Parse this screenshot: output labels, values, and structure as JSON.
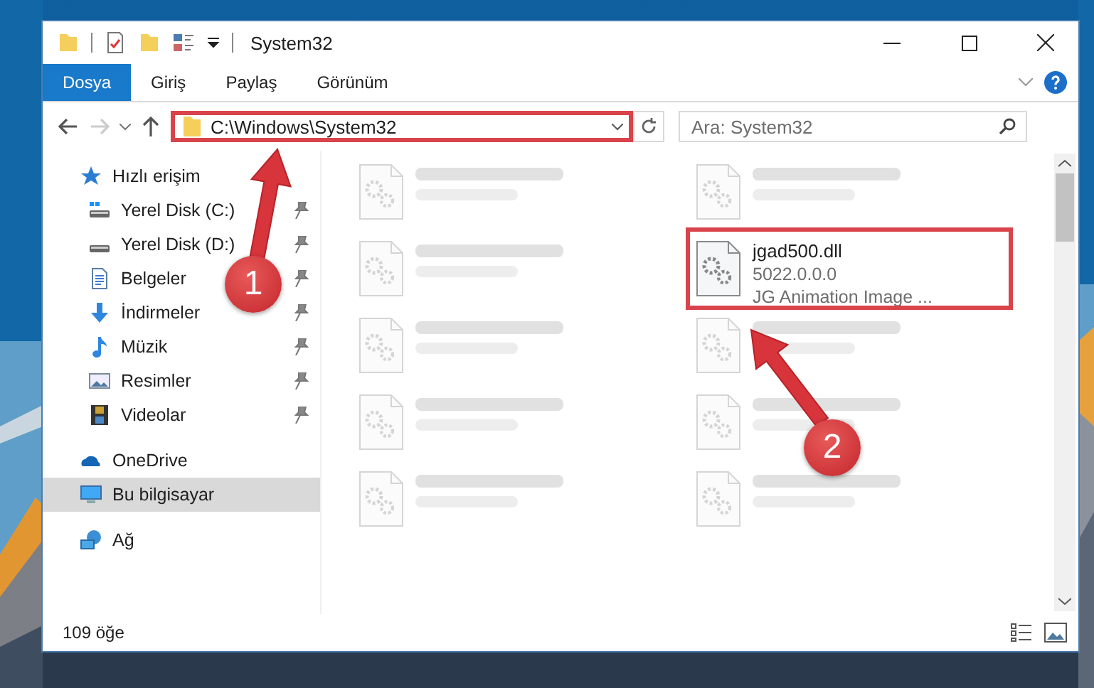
{
  "window": {
    "title": "System32"
  },
  "ribbon": {
    "tabs": [
      {
        "label": "Dosya",
        "selected": true
      },
      {
        "label": "Giriş",
        "selected": false
      },
      {
        "label": "Paylaş",
        "selected": false
      },
      {
        "label": "Görünüm",
        "selected": false
      }
    ]
  },
  "address": {
    "path": "C:\\Windows\\System32",
    "annotated": true
  },
  "search": {
    "placeholder": "Ara: System32"
  },
  "sidebar": {
    "items": [
      {
        "label": "Hızlı erişim",
        "kind": "quick",
        "selected": false,
        "children": [
          {
            "label": "Yerel Disk (C:)",
            "kind": "drive-c",
            "pinned": true,
            "selected": false
          },
          {
            "label": "Yerel Disk (D:)",
            "kind": "drive",
            "pinned": true,
            "selected": false
          },
          {
            "label": "Belgeler",
            "kind": "docs",
            "pinned": true,
            "selected": false
          },
          {
            "label": "İndirmeler",
            "kind": "download",
            "pinned": true,
            "selected": false
          },
          {
            "label": "Müzik",
            "kind": "music",
            "pinned": true,
            "selected": false
          },
          {
            "label": "Resimler",
            "kind": "pictures",
            "pinned": true,
            "selected": false
          },
          {
            "label": "Videolar",
            "kind": "videos",
            "pinned": true,
            "selected": false
          }
        ]
      },
      {
        "label": "OneDrive",
        "kind": "cloud",
        "selected": false
      },
      {
        "label": "Bu bilgisayar",
        "kind": "pc",
        "selected": true
      },
      {
        "label": "Ağ",
        "kind": "network",
        "selected": false
      }
    ]
  },
  "files": [
    {
      "blurred": true,
      "annotated": false
    },
    {
      "blurred": true,
      "annotated": false
    },
    {
      "blurred": true,
      "annotated": false
    },
    {
      "name": "jgad500.dll",
      "details": [
        "5022.0.0.0",
        "JG Animation Image ..."
      ],
      "blurred": false,
      "annotated": true
    },
    {
      "blurred": true,
      "annotated": false
    },
    {
      "blurred": true,
      "annotated": false
    },
    {
      "blurred": true,
      "annotated": false
    },
    {
      "blurred": true,
      "annotated": false
    },
    {
      "blurred": true,
      "annotated": false
    },
    {
      "blurred": true,
      "annotated": false
    }
  ],
  "status_bar": {
    "count": "109 öğe"
  },
  "annotations": [
    {
      "number": "1"
    },
    {
      "number": "2"
    }
  ]
}
